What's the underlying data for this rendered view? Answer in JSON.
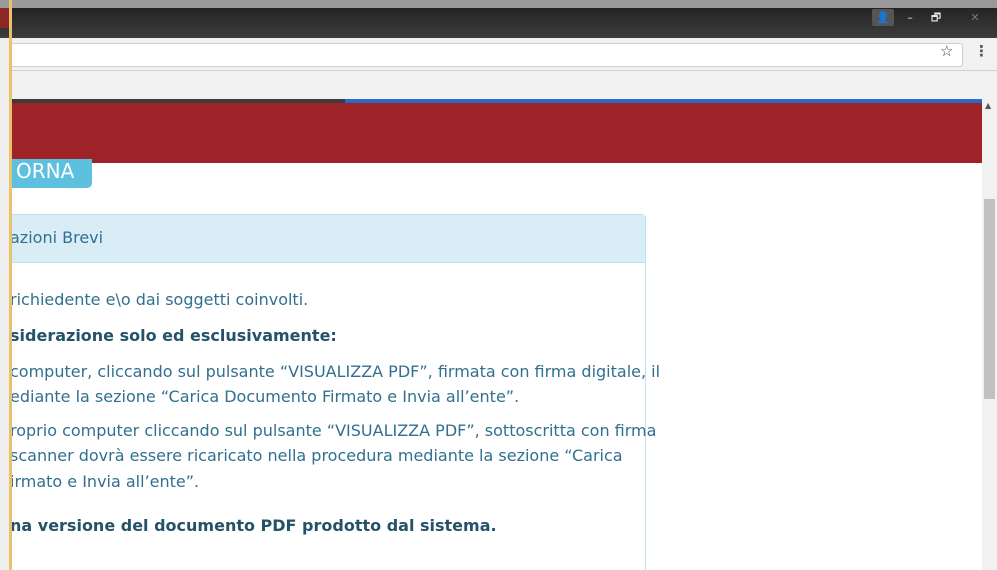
{
  "window": {
    "controls": {
      "user": "👤",
      "minimize": "–",
      "restore": "🗗",
      "close": "✕"
    }
  },
  "toolbar": {
    "star_icon": "☆",
    "menu_icon": "⋮"
  },
  "page": {
    "button_text": "ORNA",
    "panel": {
      "title": "azioni Brevi",
      "lines": [
        "richiedente e\\o dai soggetti coinvolti.",
        "siderazione solo ed esclusivamente:",
        "computer, cliccando sul pulsante “VISUALIZZA PDF”, firmata con firma digitale, il",
        "ediante la sezione “Carica Documento Firmato e Invia all’ente”.",
        "roprio computer cliccando sul pulsante “VISUALIZZA PDF”, sottoscritta con firma",
        "scanner dovrà essere ricaricato nella procedura mediante la sezione “Carica",
        "irmato e Invia all’ente”.",
        "na versione del documento PDF prodotto dal sistema."
      ]
    }
  },
  "colors": {
    "banner": "#9d2329",
    "accent_button": "#5cc0de",
    "panel_head": "#d9edf7",
    "panel_text": "#31708f"
  }
}
